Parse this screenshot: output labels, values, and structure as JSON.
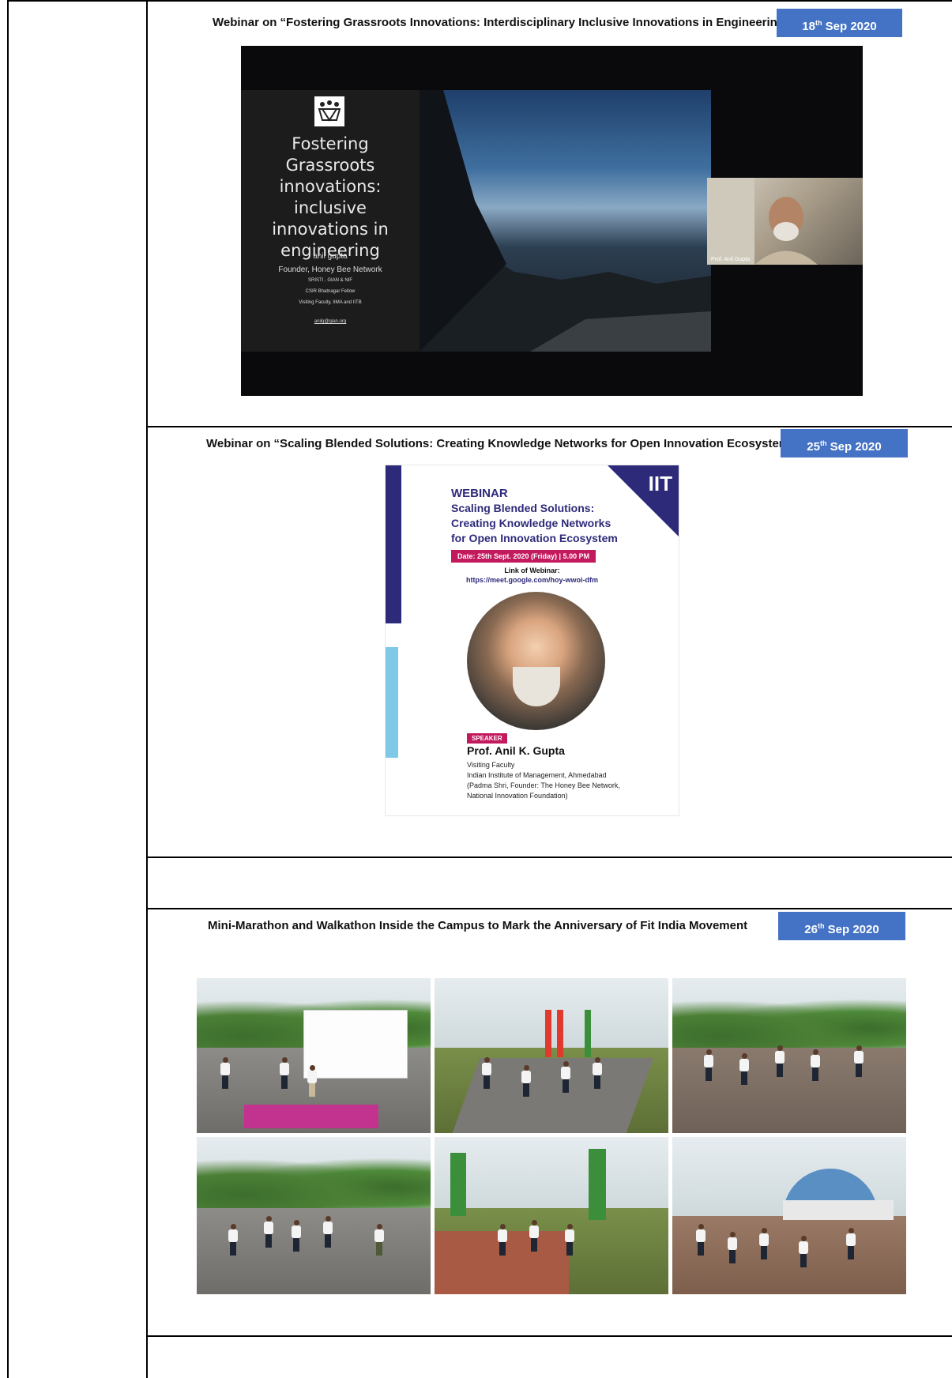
{
  "sections": [
    {
      "caption": "Webinar on “Fostering Grassroots Innovations: Interdisciplinary Inclusive Innovations in Engineering”",
      "date_day": "18",
      "date_sup": "th",
      "date_rest": " Sep 2020",
      "slide": {
        "title": "Fostering Grassroots innovations: inclusive innovations in engineering",
        "presenter": "anil gupta",
        "role": "Founder, Honey Bee Network",
        "line1": "SRISTI , GIAN & NIF",
        "line2": "CSIR Bhatnagar Fellow",
        "line3": "Visiting Faculty, IIMA and IITB",
        "email": "anilg@gian.org",
        "participant": "Prof. Anil Gupta"
      }
    },
    {
      "caption": "Webinar on “Scaling Blended Solutions: Creating Knowledge Networks for Open Innovation Ecosystem”",
      "date_day": "25",
      "date_sup": "th",
      "date_rest": " Sep 2020",
      "poster": {
        "logo": "IIT",
        "kicker": "WEBINAR",
        "title": "Scaling Blended Solutions: Creating Knowledge Networks for Open Innovation Ecosystem",
        "date": "Date: 25th Sept. 2020 (Friday)  |  5.00 PM",
        "link_label": "Link of Webinar:",
        "link": "https://meet.google.com/hoy-wwoi-dfm",
        "speaker_tag": "SPEAKER",
        "speaker_name": "Prof. Anil K. Gupta",
        "speaker_line1": "Visiting Faculty",
        "speaker_line2": "Indian Institute of Management, Ahmedabad",
        "speaker_line3": "(Padma Shri, Founder: The Honey Bee Network,",
        "speaker_line4": "National Innovation Foundation)"
      }
    },
    {
      "caption": "Mini-Marathon and Walkathon Inside the Campus to Mark the Anniversary of Fit India Movement",
      "date_day": "26",
      "date_sup": "th",
      "date_rest": " Sep 2020"
    }
  ]
}
